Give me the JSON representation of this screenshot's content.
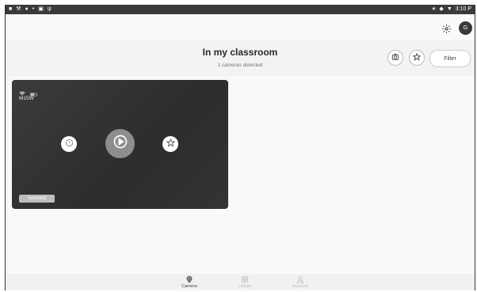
{
  "status_bar": {
    "time": "3:10 P",
    "left_icons": [
      "app-icon",
      "wrench-icon",
      "location-icon",
      "dot-icon",
      "bag-icon",
      "usb-icon"
    ],
    "right_icons": [
      "bluetooth-icon",
      "volume-icon",
      "wifi-icon"
    ]
  },
  "top_bar": {
    "avatar_initial": "G"
  },
  "header": {
    "title": "In my classroom",
    "subtitle": "1 cameras detected",
    "filter_label": "Filter"
  },
  "camera_card": {
    "name": "M15W",
    "selected_label": "Selected"
  },
  "bottom_nav": {
    "items": [
      {
        "label": "Camera",
        "icon": "camera-icon",
        "active": true
      },
      {
        "label": "Library",
        "icon": "grid-icon",
        "active": false
      },
      {
        "label": "Account",
        "icon": "person-icon",
        "active": false
      }
    ]
  },
  "colors": {
    "card_bg": "#333333",
    "play_button": "#8d8d8d",
    "status_bar": "#3a3a3a"
  }
}
